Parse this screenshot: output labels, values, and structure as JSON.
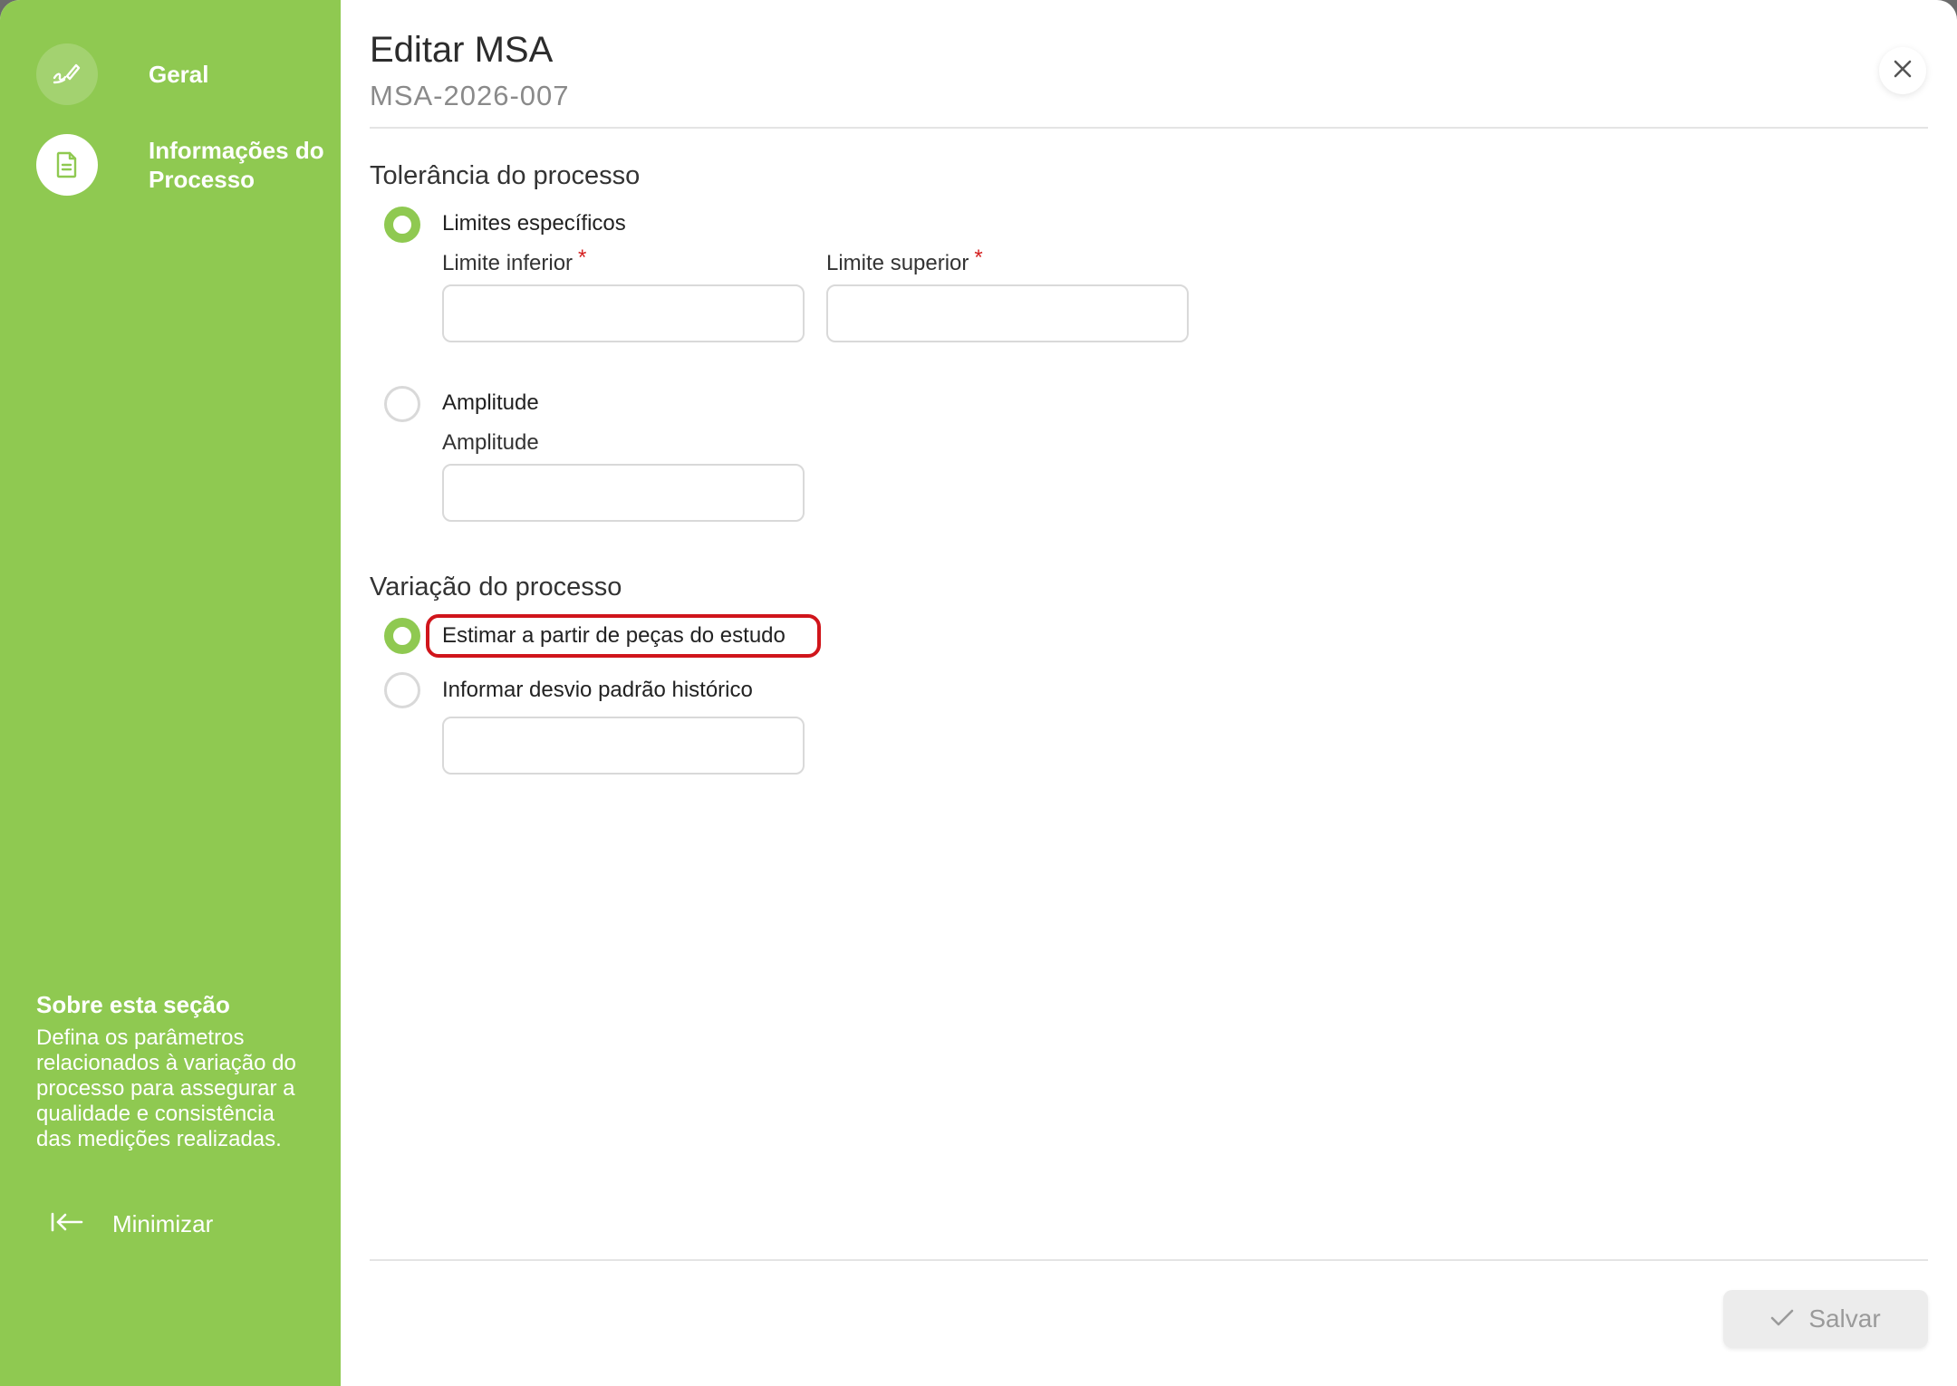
{
  "sidebar": {
    "steps": [
      {
        "label": "Geral",
        "icon": "signature-icon",
        "state": "done"
      },
      {
        "label": "Informações do Processo",
        "icon": "document-icon",
        "state": "active"
      }
    ],
    "about_title": "Sobre esta seção",
    "about_text": "Defina os parâmetros relacionados à variação do processo para assegurar a qualidade e consistência das medições realizadas.",
    "minimize_label": "Minimizar"
  },
  "header": {
    "title": "Editar MSA",
    "subtitle": "MSA-2026-007"
  },
  "tolerance": {
    "section_title": "Tolerância do processo",
    "option_specific": "Limites específicos",
    "lower_limit_label": "Limite inferior",
    "upper_limit_label": "Limite superior",
    "required_mark": "*",
    "lower_limit_value": "",
    "upper_limit_value": "",
    "option_amplitude": "Amplitude",
    "amplitude_label": "Amplitude",
    "amplitude_value": ""
  },
  "variation": {
    "section_title": "Variação do processo",
    "option_estimate": "Estimar a partir de peças do estudo",
    "option_historical": "Informar desvio padrão histórico",
    "historical_value": ""
  },
  "footer": {
    "save_label": "Salvar"
  },
  "colors": {
    "sidebar_bg": "#8fc951",
    "accent": "#8fc951",
    "required": "#d42020",
    "highlight": "#d0151b"
  }
}
